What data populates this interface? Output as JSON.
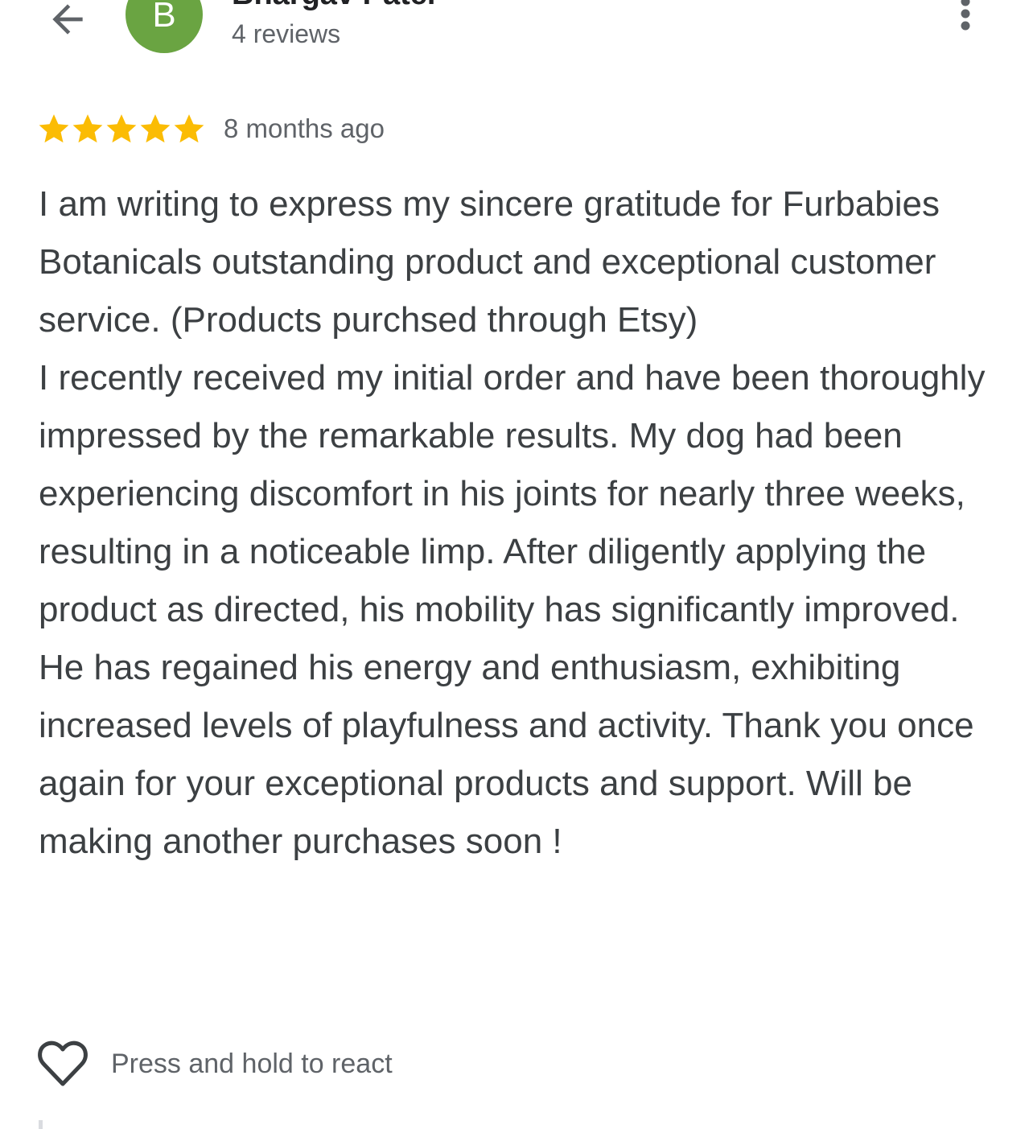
{
  "header": {
    "back_icon": "arrow-left-icon",
    "avatar_letter": "B",
    "avatar_color": "#6aa442",
    "reviewer_name": "Bhargav Patel",
    "review_count": "4 reviews",
    "more_icon": "more-vertical-icon"
  },
  "review": {
    "rating": 5,
    "rating_max": 5,
    "star_color": "#fbbc04",
    "date": "8 months ago",
    "paragraphs": [
      "I am writing to express my sincere gratitude for Furbabies Botanicals outstanding product and exceptional customer service. (Products purchsed through Etsy)",
      "I recently received my initial order and have been thoroughly impressed by the remarkable results. My dog had been experiencing discomfort in his joints for nearly three weeks, resulting in a noticeable limp. After diligently applying the product as directed, his mobility has significantly improved. He has regained his energy and enthusiasm, exhibiting increased levels of playfulness and activity. Thank you once again for your exceptional products and support. Will be making another purchases soon !"
    ]
  },
  "react": {
    "icon": "heart-outline-icon",
    "label": "Press and hold to react"
  }
}
